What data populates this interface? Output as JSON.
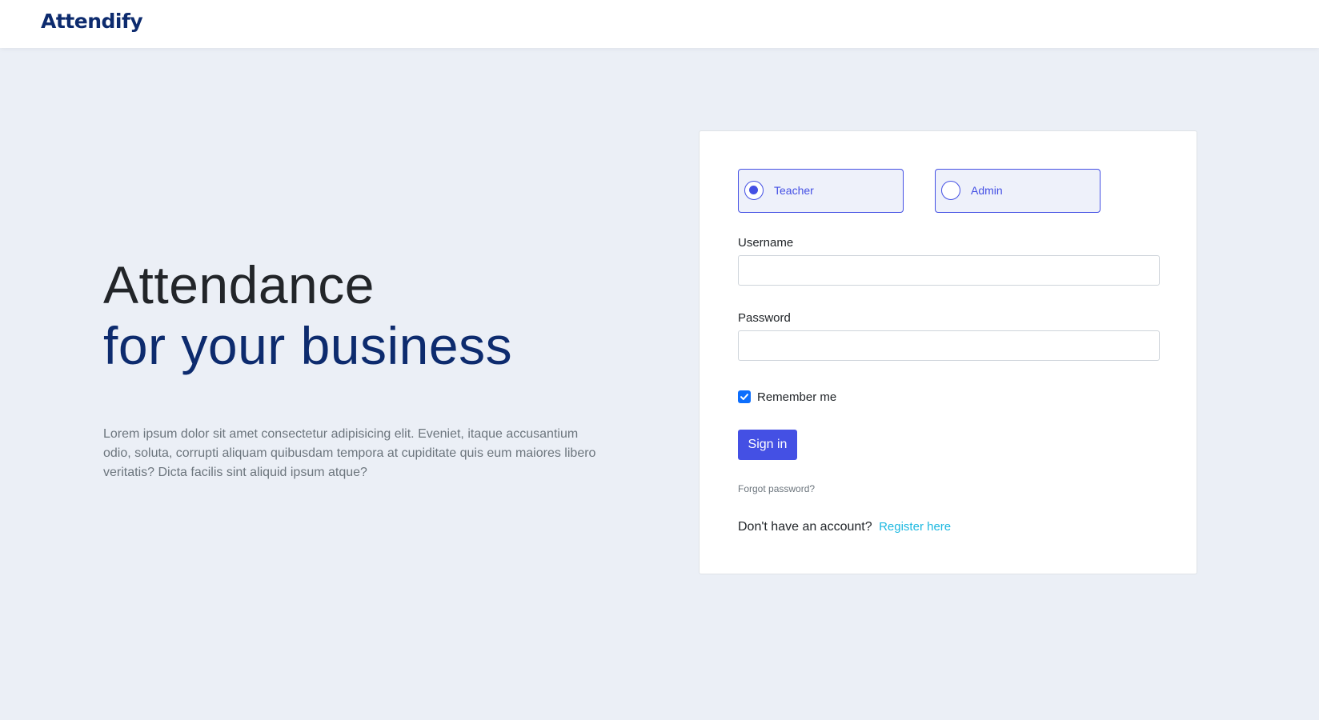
{
  "header": {
    "brand": "Attendify"
  },
  "hero": {
    "title_line1": "Attendance",
    "title_line2": "for your business",
    "description": "Lorem ipsum dolor sit amet consectetur adipisicing elit. Eveniet, itaque accusantium odio, soluta, corrupti aliquam quibusdam tempora at cupiditate quis eum maiores libero veritatis? Dicta facilis sint aliquid ipsum atque?"
  },
  "login": {
    "roles": [
      {
        "label": "Teacher",
        "selected": true
      },
      {
        "label": "Admin",
        "selected": false
      }
    ],
    "username": {
      "label": "Username",
      "value": ""
    },
    "password": {
      "label": "Password",
      "value": ""
    },
    "remember": {
      "label": "Remember me",
      "checked": true
    },
    "signin_label": "Sign in",
    "forgot_label": "Forgot password?",
    "register_prompt": "Don't have an account?",
    "register_link": "Register here"
  },
  "colors": {
    "brand": "#0d2b6e",
    "accent": "#4450e4",
    "link": "#1cb8e0",
    "checkbox": "#0d6efd",
    "background": "#ebeff6"
  }
}
